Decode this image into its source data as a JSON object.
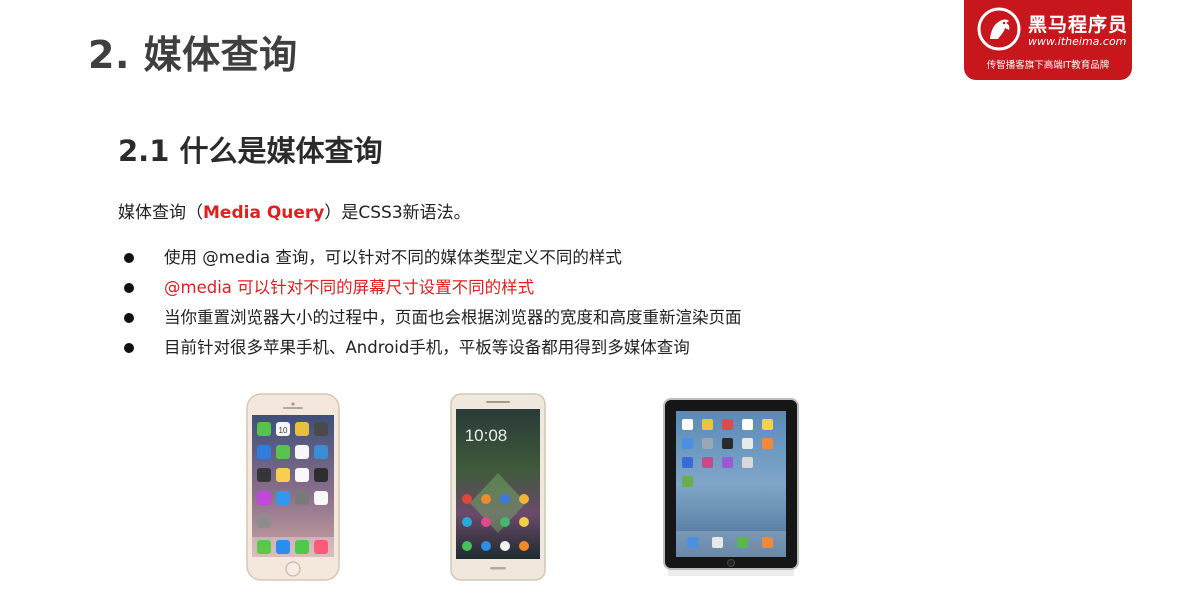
{
  "header": {
    "title": "2. 媒体查询"
  },
  "logo": {
    "name": "黑马程序员",
    "url": "www.itheima.com",
    "slogan": "传智播客旗下高端IT教育品牌",
    "accent": "#c8161d"
  },
  "section": {
    "title": "2.1 什么是媒体查询",
    "intro_before": "媒体查询（",
    "intro_highlight": "Media Query",
    "intro_after": "）是CSS3新语法。",
    "highlight_color": "#e02020"
  },
  "bullets": [
    {
      "text": "使用 @media 查询，可以针对不同的媒体类型定义不同的样式"
    },
    {
      "text": "@media 可以针对不同的屏幕尺寸设置不同的样式"
    },
    {
      "text": "当你重置浏览器大小的过程中，页面也会根据浏览器的宽度和高度重新渲染页面"
    },
    {
      "text": "目前针对很多苹果手机、Android手机，平板等设备都用得到多媒体查询"
    }
  ],
  "images": {
    "iphone_clock": "10",
    "android_time": "10:08"
  }
}
